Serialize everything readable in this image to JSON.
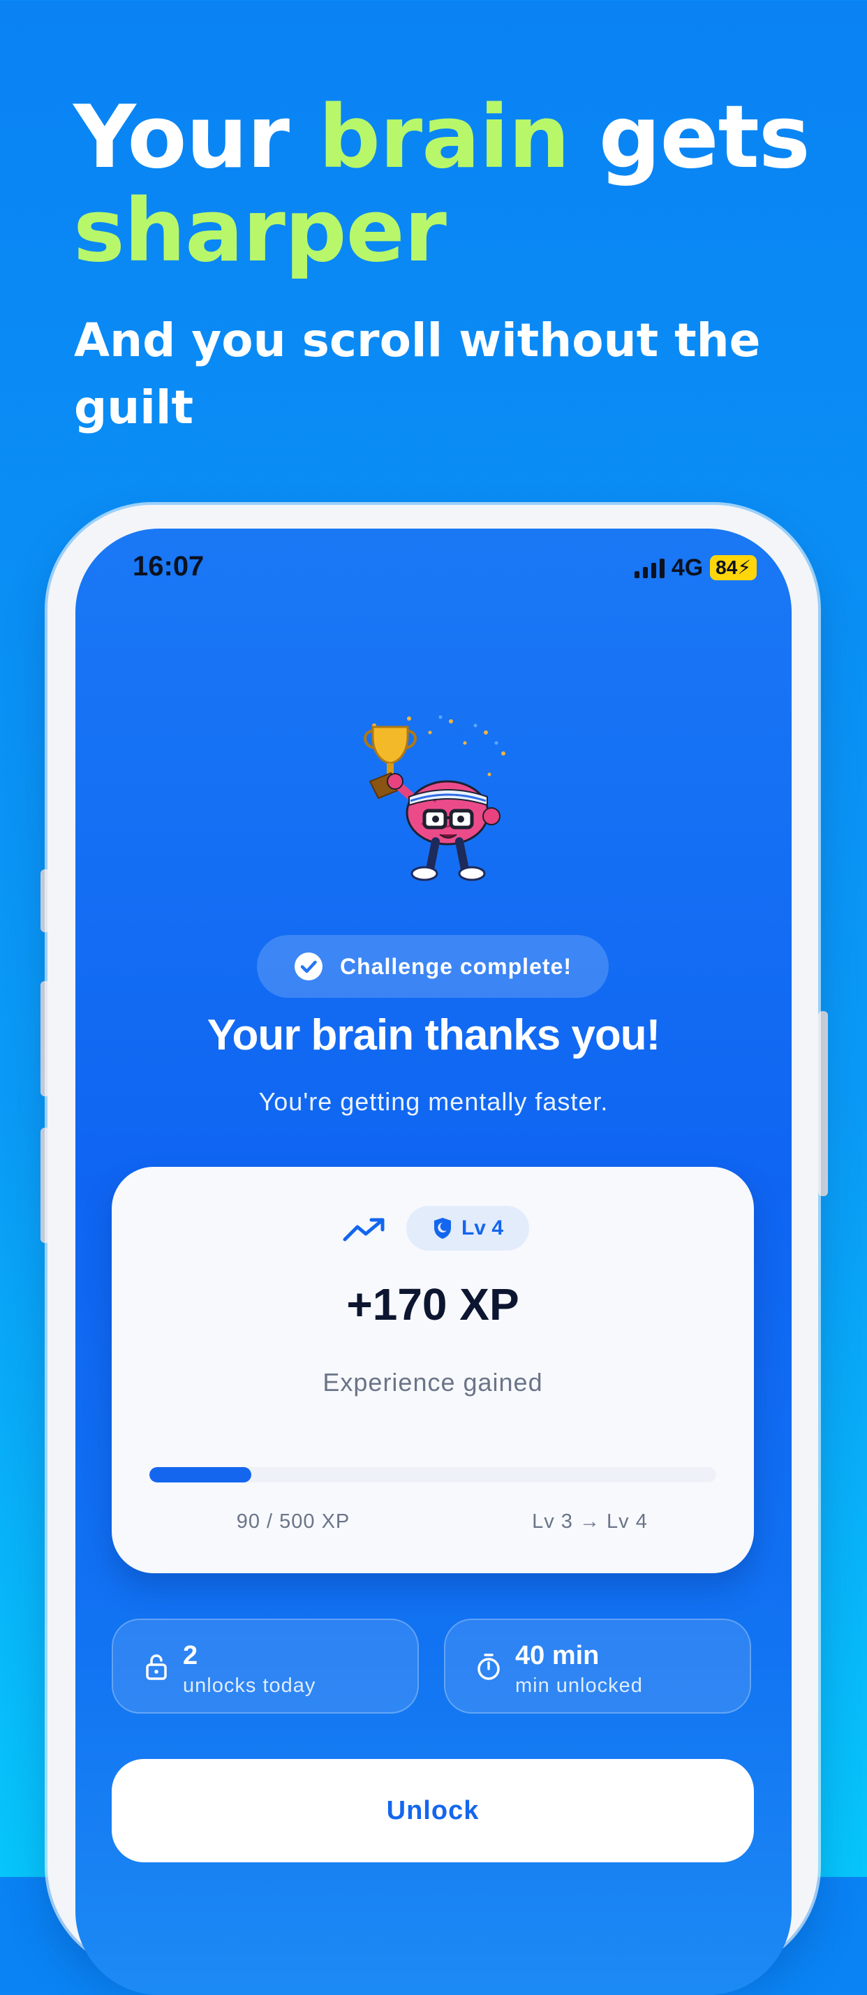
{
  "headline": {
    "line1_word1": "Your",
    "line1_accent": "brain",
    "line1_word3": "gets",
    "line2_accent": "sharper",
    "subhead": "And you scroll without the guilt"
  },
  "colors": {
    "accent_green": "#B9F76A",
    "brand_blue": "#1466EE",
    "battery_yellow": "#FFD60A"
  },
  "status_bar": {
    "time": "16:07",
    "network": "4G",
    "battery": "84"
  },
  "mascot": {
    "icon": "trophy-brain-mascot"
  },
  "badge": {
    "icon": "check-circle-icon",
    "label": "Challenge complete!"
  },
  "title": "Your brain thanks you!",
  "subtitle": "You're getting mentally faster.",
  "xp_card": {
    "trend_icon": "trending-up-icon",
    "level_icon": "shield-icon",
    "level_label": "Lv 4",
    "xp_gained": "+170 XP",
    "caption": "Experience gained",
    "progress_fraction": 0.18,
    "progress_text": "90 / 500 XP",
    "level_change": "Lv 3 → Lv 4"
  },
  "stats": [
    {
      "icon": "lock-open-icon",
      "value": "2",
      "label": "unlocks today"
    },
    {
      "icon": "stopwatch-icon",
      "value": "40 min",
      "label": "min unlocked"
    }
  ],
  "unlock_button": "Unlock"
}
